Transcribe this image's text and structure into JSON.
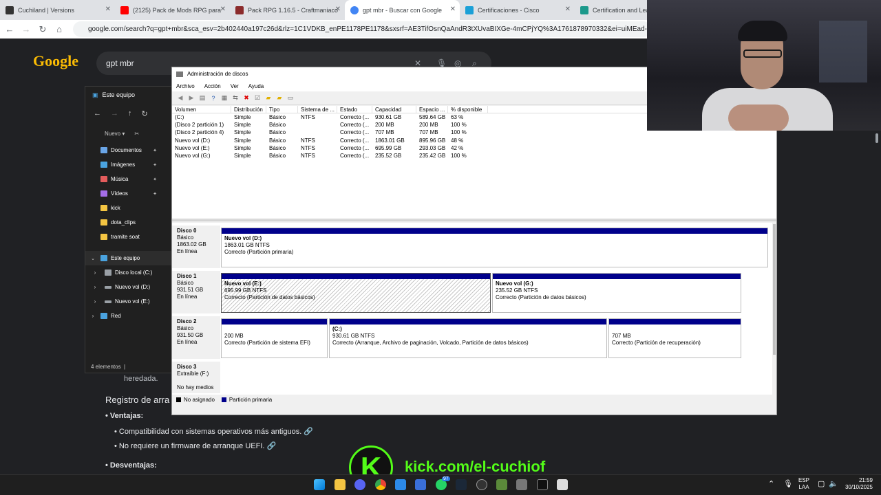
{
  "browser": {
    "tabs": [
      {
        "title": "Cuchiland | Versions",
        "color": "#333333"
      },
      {
        "title": "(2125) Pack de Mods RPG para",
        "color": "#ff0000"
      },
      {
        "title": "Pack RPG 1.16.5 - Craftmaniaco",
        "color": "#8b2b2b"
      },
      {
        "title": "gpt mbr - Buscar con Google",
        "color": "#4285f4"
      },
      {
        "title": "Certificaciones - Cisco",
        "color": "#1ba0d7"
      },
      {
        "title": "Certification and Learning",
        "color": "#1b998b"
      }
    ],
    "url": "google.com/search?q=gpt+mbr&sca_esv=2b402440a197c26d&rlz=1C1VDKB_enPE1178PE1178&sxsrf=AE3TifOsnQaAndR3tXUvaBIXGe-4mCPjYQ%3A1761878970332&ei=uiMEad-JFJbX1sQP2v2RoA"
  },
  "google": {
    "logo": "Google",
    "query": "gpt mbr",
    "heredada": "heredada.",
    "section_title": "Registro de arra",
    "ventajas_label": "Ventajas:",
    "ventaja_1": "Compatibilidad con sistemas operativos más antiguos.",
    "ventaja_2": "No requiere un firmware de arranque UEFI.",
    "desventajas_label": "Desventajas:"
  },
  "explorer": {
    "title": "Este equipo",
    "new_label": "Nuevo",
    "status": "4 elementos",
    "items": [
      {
        "label": "Documentos",
        "color": "#6aa5e6",
        "pinned": true
      },
      {
        "label": "Imágenes",
        "color": "#4aa3df",
        "pinned": true
      },
      {
        "label": "Música",
        "color": "#e45c5c",
        "pinned": true
      },
      {
        "label": "Vídeos",
        "color": "#a46ee8",
        "pinned": true
      },
      {
        "label": "kick",
        "color": "#f4c542",
        "pinned": false
      },
      {
        "label": "dota_clips",
        "color": "#f4c542",
        "pinned": false
      },
      {
        "label": "tramite soat",
        "color": "#f4c542",
        "pinned": false
      }
    ],
    "tree": [
      {
        "label": "Este equipo",
        "color": "#4aa3df"
      },
      {
        "label": "Disco local (C:)",
        "color": "#9aa0a6"
      },
      {
        "label": "Nuevo vol (D:)",
        "color": "#9aa0a6"
      },
      {
        "label": "Nuevo vol (E:)",
        "color": "#9aa0a6"
      },
      {
        "label": "Red",
        "color": "#4aa3df"
      }
    ]
  },
  "diskmgmt": {
    "title": "Administración de discos",
    "menu": [
      "Archivo",
      "Acción",
      "Ver",
      "Ayuda"
    ],
    "columns": [
      "Volumen",
      "Distribución",
      "Tipo",
      "Sistema de ...",
      "Estado",
      "Capacidad",
      "Espacio ...",
      "% disponible"
    ],
    "volumes": [
      [
        "(C:)",
        "Simple",
        "Básico",
        "NTFS",
        "Correcto (...",
        "930.61 GB",
        "589.64 GB",
        "63 %"
      ],
      [
        "(Disco 2 partición 1)",
        "Simple",
        "Básico",
        "",
        "Correcto (...",
        "200 MB",
        "200 MB",
        "100 %"
      ],
      [
        "(Disco 2 partición 4)",
        "Simple",
        "Básico",
        "",
        "Correcto (...",
        "707 MB",
        "707 MB",
        "100 %"
      ],
      [
        "Nuevo vol (D:)",
        "Simple",
        "Básico",
        "NTFS",
        "Correcto (...",
        "1863.01 GB",
        "895.96 GB",
        "48 %"
      ],
      [
        "Nuevo vol (E:)",
        "Simple",
        "Básico",
        "NTFS",
        "Correcto (...",
        "695.99 GB",
        "293.03 GB",
        "42 %"
      ],
      [
        "Nuevo vol (G:)",
        "Simple",
        "Básico",
        "NTFS",
        "Correcto (...",
        "235.52 GB",
        "235.42 GB",
        "100 %"
      ]
    ],
    "disks": [
      {
        "name": "Disco 0",
        "type": "Básico",
        "size": "1863.02 GB",
        "status": "En línea",
        "partitions": [
          {
            "name": "Nuevo vol  (D:)",
            "size": "1863.01 GB NTFS",
            "status": "Correcto (Partición primaria)"
          }
        ]
      },
      {
        "name": "Disco 1",
        "type": "Básico",
        "size": "931.51 GB",
        "status": "En línea",
        "partitions": [
          {
            "name": "Nuevo vol  (E:)",
            "size": "695.99 GB NTFS",
            "status": "Correcto (Partición de datos básicos)"
          },
          {
            "name": "Nuevo vol  (G:)",
            "size": "235.52 GB NTFS",
            "status": "Correcto (Partición de datos básicos)"
          }
        ]
      },
      {
        "name": "Disco 2",
        "type": "Básico",
        "size": "931.50 GB",
        "status": "En línea",
        "partitions": [
          {
            "name": "",
            "size": "200 MB",
            "status": "Correcto (Partición de sistema EFI)"
          },
          {
            "name": "(C:)",
            "size": "930.61 GB NTFS",
            "status": "Correcto (Arranque, Archivo de paginación, Volcado, Partición de datos básicos)"
          },
          {
            "name": "",
            "size": "707 MB",
            "status": "Correcto (Partición de recuperación)"
          }
        ]
      },
      {
        "name": "Disco 3",
        "type": "Extraíble (F:)",
        "size": "",
        "status": "No hay medios",
        "partitions": []
      }
    ],
    "legend": [
      {
        "label": "No asignado",
        "color": "#000000"
      },
      {
        "label": "Partición primaria",
        "color": "#00008b"
      }
    ]
  },
  "overlay": {
    "kick_letter": "K",
    "kick_url": "kick.com/el-cuchiof"
  },
  "taskbar": {
    "lang_1": "ESP",
    "lang_2": "LAA",
    "time": "21:59",
    "date": "30/10/2025",
    "notification_badge": "97"
  }
}
